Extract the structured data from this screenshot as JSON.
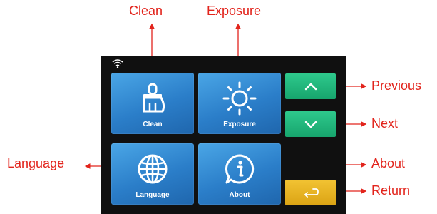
{
  "annotations": {
    "clean": "Clean",
    "exposure": "Exposure",
    "previous": "Previous",
    "next": "Next",
    "language": "Language",
    "about": "About",
    "return": "Return"
  },
  "tiles": {
    "clean": "Clean",
    "exposure": "Exposure",
    "language": "Language",
    "about": "About"
  },
  "icons": {
    "status": "wifi-icon",
    "clean": "brush-icon",
    "exposure": "sun-icon",
    "language": "globe-icon",
    "about": "info-icon",
    "previous": "chevron-up-icon",
    "next": "chevron-down-icon",
    "return": "return-arrow-icon"
  },
  "colors": {
    "annotation": "#e2241c",
    "screen_bg": "#101010",
    "tile_blue": "#2b7ec9",
    "nav_green": "#1fb57a",
    "return_yellow": "#f0bd2a"
  }
}
